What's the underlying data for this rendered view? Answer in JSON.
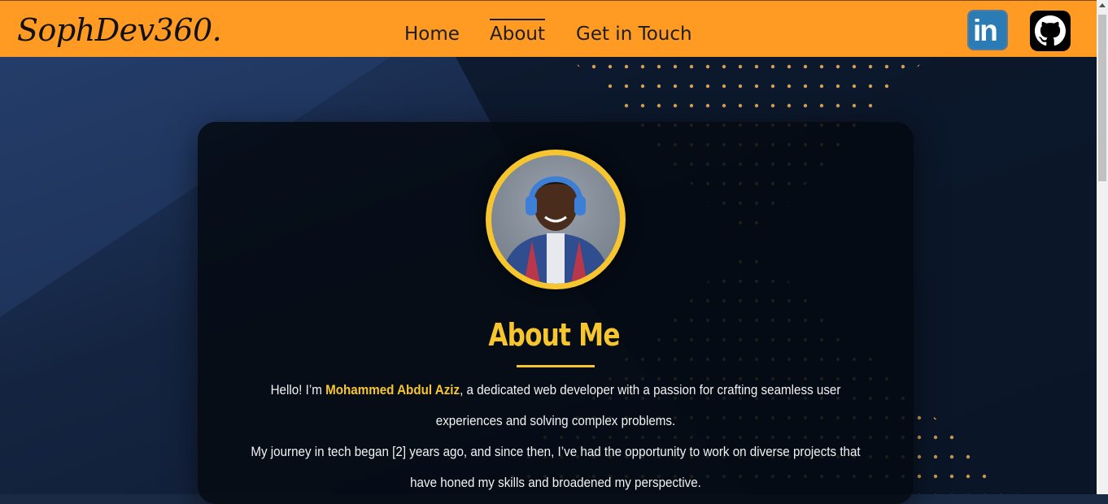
{
  "header": {
    "logo": "SophDev360.",
    "nav": [
      {
        "label": "Home",
        "active": false
      },
      {
        "label": "About",
        "active": true
      },
      {
        "label": "Get in Touch",
        "active": false
      }
    ],
    "social": [
      {
        "name": "linkedin",
        "icon": "linkedin-icon",
        "glyph": "in"
      },
      {
        "name": "github",
        "icon": "github-icon"
      }
    ],
    "colors": {
      "bar": "#ff9b22",
      "text": "#1d1d1d"
    }
  },
  "about": {
    "title": "About Me",
    "intro_prefix": "Hello! I’m ",
    "name": "Mohammed Abdul Aziz",
    "intro_suffix": ", a dedicated web developer with a passion for crafting seamless user experiences and solving complex problems.",
    "journey": "My journey in tech began [2] years ago, and since then, I’ve had the opportunity to work on diverse projects that have honed my skills and broadened my perspective.",
    "accent": "#f7c62e"
  }
}
